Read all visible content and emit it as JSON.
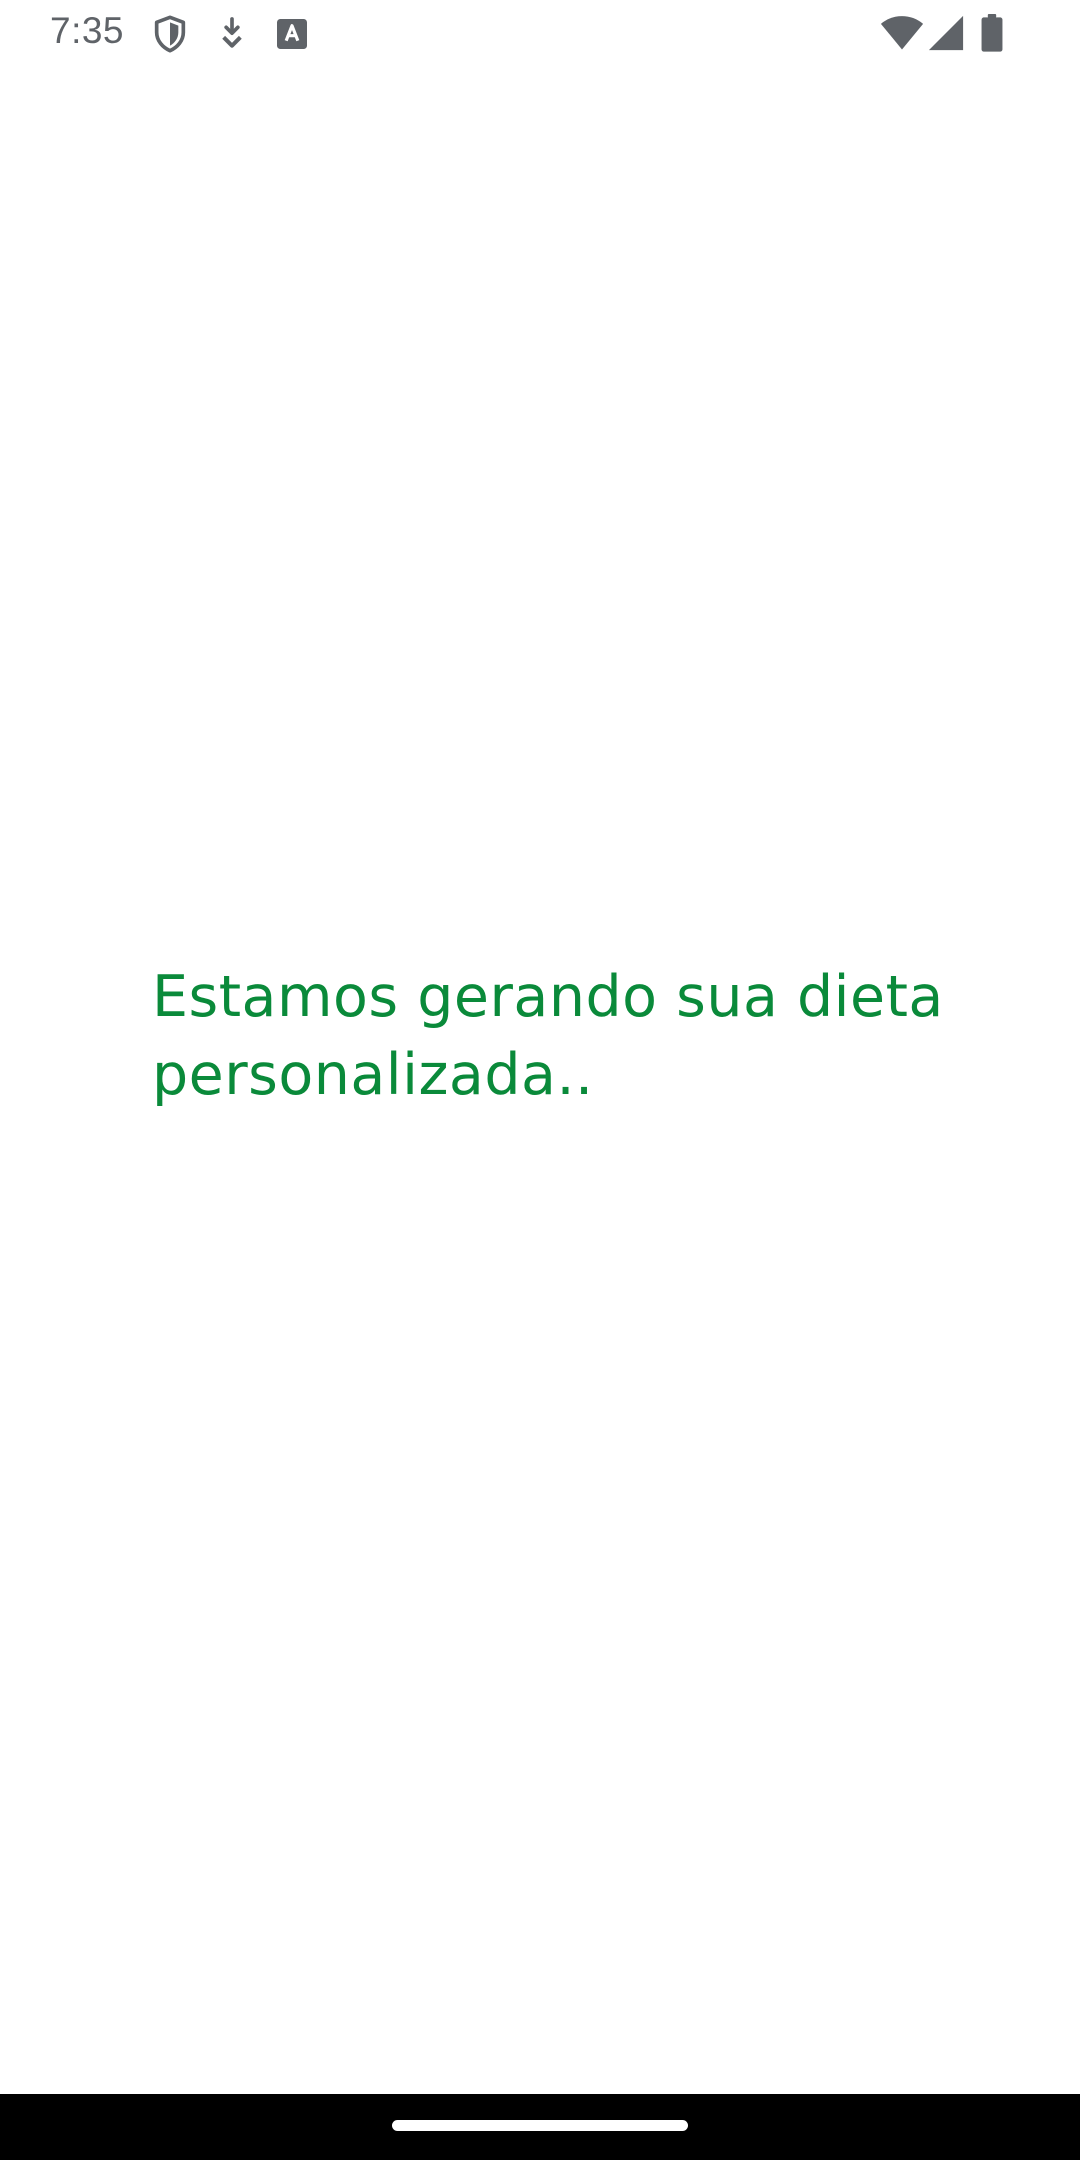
{
  "status_bar": {
    "time": "7:35",
    "left_icons": [
      "shield-icon",
      "download-icon",
      "font-download-icon"
    ],
    "right_icons": [
      "wifi-icon",
      "cellular-signal-icon",
      "battery-icon"
    ],
    "icon_color": "#5f6368"
  },
  "main": {
    "loading_message": "Estamos gerando sua dieta personalizada..",
    "text_color": "#0a8a3a",
    "background_color": "#ffffff"
  },
  "nav_bar": {
    "background_color": "#000000",
    "handle_color": "#ffffff"
  }
}
